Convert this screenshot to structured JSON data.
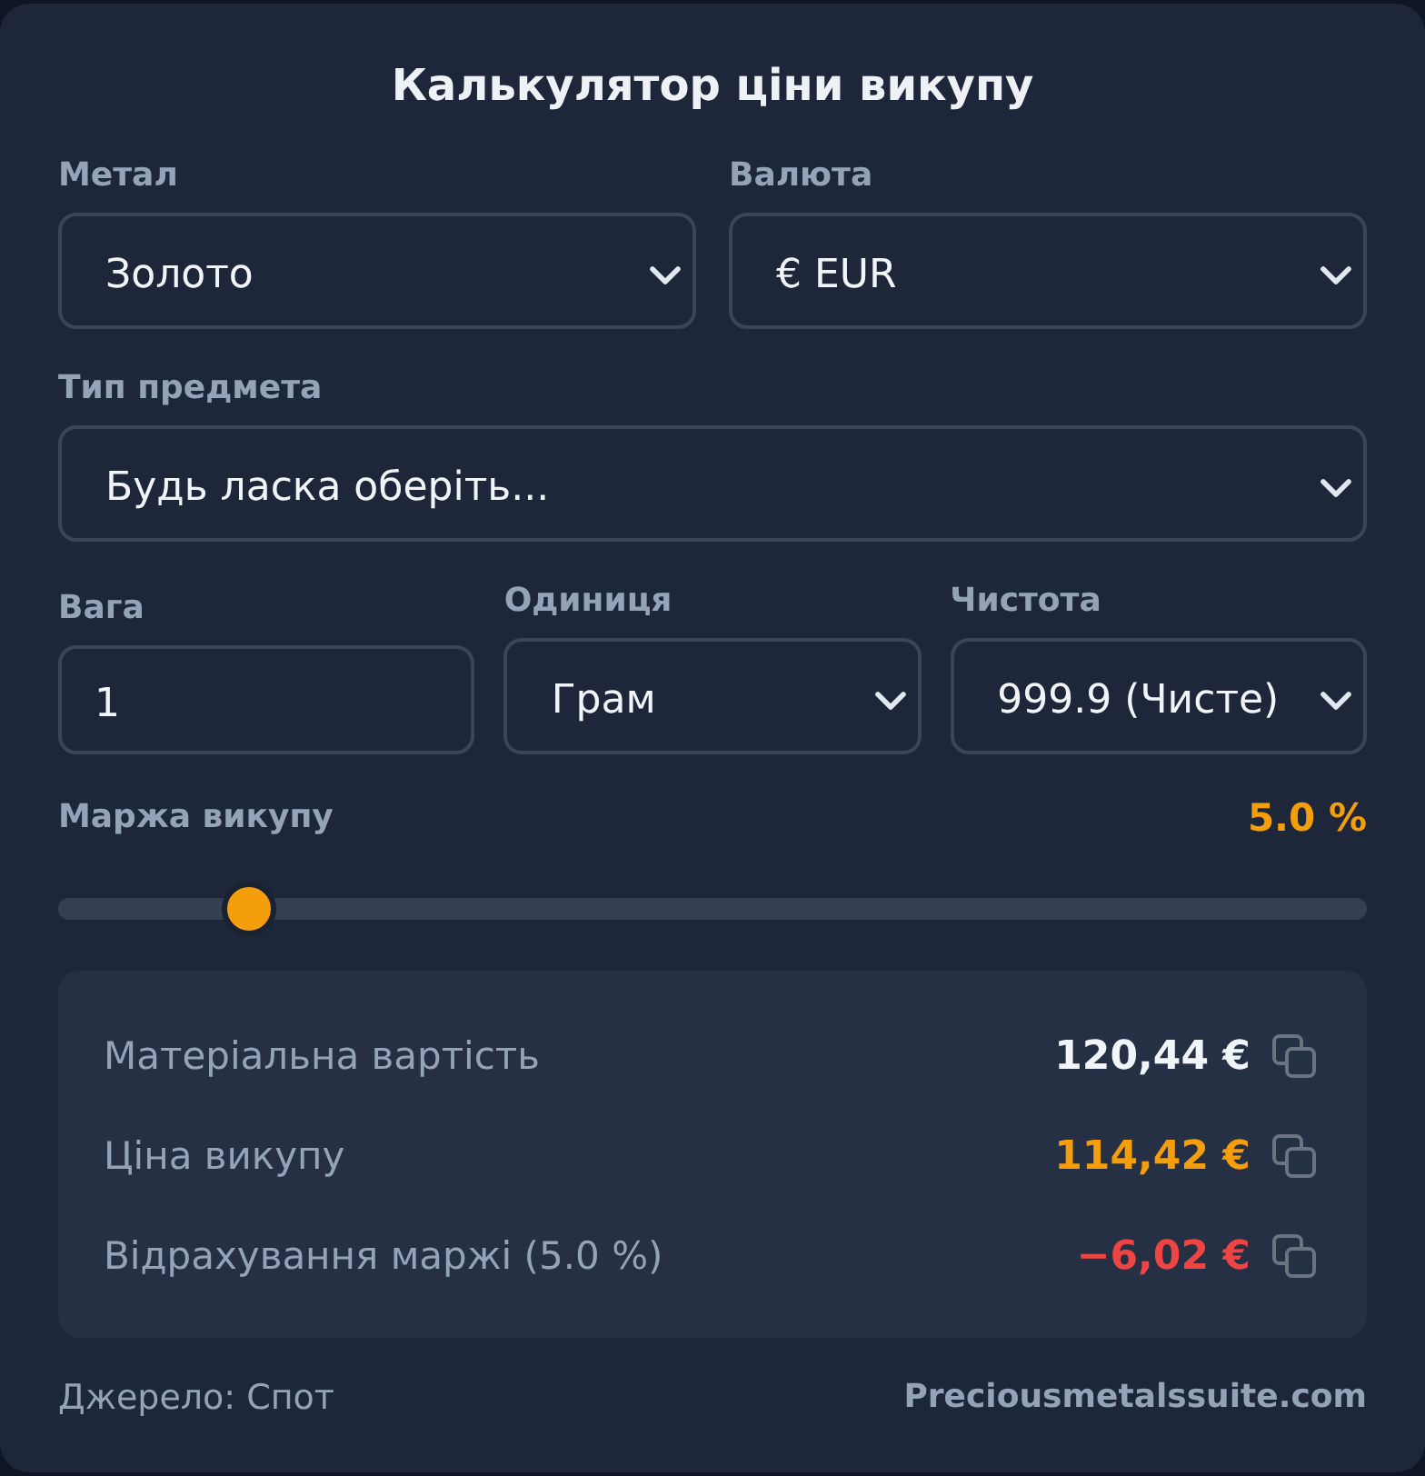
{
  "title": "Калькулятор ціни викупу",
  "form_rows": [
    [
      {
        "kind": "select",
        "label": "Метал",
        "value": "Золото"
      },
      {
        "kind": "select",
        "label": "Валюта",
        "value": "€ EUR"
      }
    ],
    [
      {
        "kind": "select",
        "label": "Тип предмета",
        "value": "Будь ласка оберіть..."
      }
    ],
    [
      {
        "kind": "input",
        "label": "Вага",
        "value": "1"
      },
      {
        "kind": "select",
        "label": "Одиниця",
        "value": "Грам"
      },
      {
        "kind": "select",
        "label": "Чистота",
        "value": "999.9 (Чисте)"
      }
    ]
  ],
  "margin": {
    "label": "Маржа викупу",
    "reading": "5.0 %",
    "level": 0.13
  },
  "results": [
    {
      "label": "Матеріальна вартість",
      "value": "120,44 €",
      "color": "#f1f5f9"
    },
    {
      "label": "Ціна викупу",
      "value": "114,42 €",
      "color": "#f59e0b"
    },
    {
      "label": "Відрахування маржі (5.0 %)",
      "value": "−6,02 €",
      "color": "#ef4444"
    }
  ],
  "footer": {
    "source": "Джерело: Спот",
    "site": "Preciousmetalssuite.com"
  }
}
